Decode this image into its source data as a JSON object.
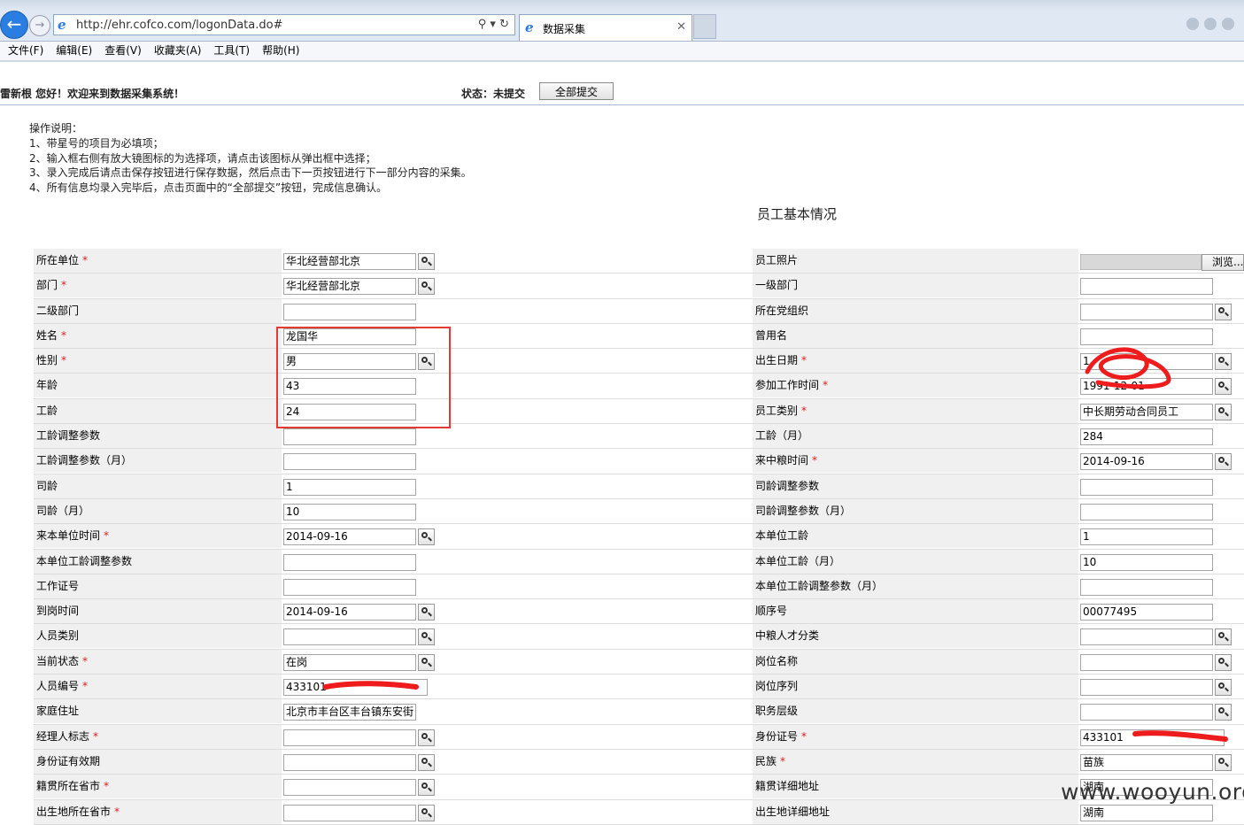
{
  "browser": {
    "url": "http://ehr.cofco.com/logonData.do#",
    "tab_title": "数据采集",
    "menu": [
      "文件(F)",
      "编辑(E)",
      "查看(V)",
      "收藏夹(A)",
      "工具(T)",
      "帮助(H)"
    ]
  },
  "header": {
    "welcome": "雷新根  您好！欢迎来到数据采集系统！",
    "status": "状态：未提交",
    "submit_all": "全部提交"
  },
  "instructions": [
    "操作说明：",
    "1、带星号的项目为必填项；",
    "2、输入框右侧有放大镜图标的为选择项，请点击该图标从弹出框中选择；",
    "3、录入完成后请点击保存按钮进行保存数据，然后点击下一页按钮进行下一部分内容的采集。",
    "4、所有信息均录入完毕后，点击页面中的“全部提交”按钮，完成信息确认。"
  ],
  "section_title": "员工基本情况",
  "form_rows": [
    {
      "l_label": "所在单位",
      "l_req": true,
      "l_value": "华北经营部北京",
      "l_lens": true,
      "r_label": "员工照片",
      "r_req": false,
      "r_value": "",
      "r_lens": false,
      "r_photo": true,
      "r_browse": "浏览..."
    },
    {
      "l_label": "部门",
      "l_req": true,
      "l_value": "华北经营部北京",
      "l_lens": true,
      "r_label": "一级部门",
      "r_req": false,
      "r_value": "",
      "r_lens": false
    },
    {
      "l_label": "二级部门",
      "l_req": false,
      "l_value": "",
      "l_lens": false,
      "r_label": "所在党组织",
      "r_req": false,
      "r_value": "",
      "r_lens": true
    },
    {
      "l_label": "姓名",
      "l_req": true,
      "l_value": "龙国华",
      "l_lens": false,
      "r_label": "曾用名",
      "r_req": false,
      "r_value": "",
      "r_lens": false
    },
    {
      "l_label": "性别",
      "l_req": true,
      "l_value": "男",
      "l_lens": true,
      "r_label": "出生日期",
      "r_req": true,
      "r_value": "1",
      "r_lens": true
    },
    {
      "l_label": "年龄",
      "l_req": false,
      "l_value": "43",
      "l_lens": false,
      "r_label": "参加工作时间",
      "r_req": true,
      "r_value": "1991-12-01",
      "r_lens": true
    },
    {
      "l_label": "工龄",
      "l_req": false,
      "l_value": "24",
      "l_lens": false,
      "r_label": "员工类别",
      "r_req": true,
      "r_value": "中长期劳动合同员工",
      "r_lens": true
    },
    {
      "l_label": "工龄调整参数",
      "l_req": false,
      "l_value": "",
      "l_lens": false,
      "r_label": "工龄（月）",
      "r_req": false,
      "r_value": "284",
      "r_lens": false
    },
    {
      "l_label": "工龄调整参数（月）",
      "l_req": false,
      "l_value": "",
      "l_lens": false,
      "r_label": "来中粮时间",
      "r_req": true,
      "r_value": "2014-09-16",
      "r_lens": true
    },
    {
      "l_label": "司龄",
      "l_req": false,
      "l_value": "1",
      "l_lens": false,
      "r_label": "司龄调整参数",
      "r_req": false,
      "r_value": "",
      "r_lens": false
    },
    {
      "l_label": "司龄（月）",
      "l_req": false,
      "l_value": "10",
      "l_lens": false,
      "r_label": "司龄调整参数（月）",
      "r_req": false,
      "r_value": "",
      "r_lens": false
    },
    {
      "l_label": "来本单位时间",
      "l_req": true,
      "l_value": "2014-09-16",
      "l_lens": true,
      "r_label": "本单位工龄",
      "r_req": false,
      "r_value": "1",
      "r_lens": false
    },
    {
      "l_label": "本单位工龄调整参数",
      "l_req": false,
      "l_value": "",
      "l_lens": false,
      "r_label": "本单位工龄（月）",
      "r_req": false,
      "r_value": "10",
      "r_lens": false
    },
    {
      "l_label": "工作证号",
      "l_req": false,
      "l_value": "",
      "l_lens": false,
      "r_label": "本单位工龄调整参数（月）",
      "r_req": false,
      "r_value": "",
      "r_lens": false
    },
    {
      "l_label": "到岗时间",
      "l_req": false,
      "l_value": "2014-09-16",
      "l_lens": true,
      "r_label": "顺序号",
      "r_req": false,
      "r_value": "00077495",
      "r_lens": false
    },
    {
      "l_label": "人员类别",
      "l_req": false,
      "l_value": "",
      "l_lens": true,
      "r_label": "中粮人才分类",
      "r_req": false,
      "r_value": "",
      "r_lens": true
    },
    {
      "l_label": "当前状态",
      "l_req": true,
      "l_value": "在岗",
      "l_lens": true,
      "r_label": "岗位名称",
      "r_req": false,
      "r_value": "",
      "r_lens": true
    },
    {
      "l_label": "人员编号",
      "l_req": true,
      "l_value": "433101",
      "l_lens": false,
      "l_wide": true,
      "r_label": "岗位序列",
      "r_req": false,
      "r_value": "",
      "r_lens": true
    },
    {
      "l_label": "家庭住址",
      "l_req": false,
      "l_value": "北京市丰台区丰台镇东安街",
      "l_lens": false,
      "r_label": "职务层级",
      "r_req": false,
      "r_value": "",
      "r_lens": true
    },
    {
      "l_label": "经理人标志",
      "l_req": true,
      "l_value": "",
      "l_lens": true,
      "r_label": "身份证号",
      "r_req": true,
      "r_value": "433101",
      "r_lens": false,
      "r_wide": true
    },
    {
      "l_label": "身份证有效期",
      "l_req": false,
      "l_value": "",
      "l_lens": true,
      "r_label": "民族",
      "r_req": true,
      "r_value": "苗族",
      "r_lens": true
    },
    {
      "l_label": "籍贯所在省市",
      "l_req": true,
      "l_value": "",
      "l_lens": true,
      "r_label": "籍贯详细地址",
      "r_req": false,
      "r_value": "湖南",
      "r_lens": false
    },
    {
      "l_label": "出生地所在省市",
      "l_req": true,
      "l_value": "",
      "l_lens": true,
      "r_label": "出生地详细地址",
      "r_req": false,
      "r_value": "湖南",
      "r_lens": false
    }
  ],
  "watermark": "www.wooyun.org"
}
